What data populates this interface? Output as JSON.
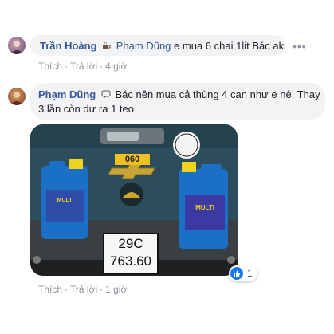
{
  "comments": [
    {
      "author": "Trần Hoàng",
      "mention": "Phạm Dũng",
      "text": "e mua 6 chai 1lit Bác ak",
      "actions": {
        "like": "Thích",
        "reply": "Trả lời",
        "time": "4 giờ"
      }
    },
    {
      "author": "Phạm Dũng",
      "text_line1": "Bác nên mua cả thùng 4 can như e nè. Thay",
      "text_line2": "3 lần còn dư ra 1 teo",
      "actions": {
        "like": "Thích",
        "reply": "Trả lời",
        "time": "1 giờ"
      },
      "reaction_count": "1"
    }
  ],
  "photo": {
    "plate_line1": "29C",
    "plate_line2": "763.60",
    "badge_small": "060",
    "left_bottle_label": "MULTI",
    "right_bottle_label": "MULTI"
  },
  "icons": {
    "emoji1": "coffee-emoji-icon",
    "emoji2": "speech-emoji-icon",
    "more": "more-options-icon",
    "like": "like-thumb-icon"
  },
  "colors": {
    "link": "#385898",
    "bubble": "#f2f3f5",
    "meta": "#90949c",
    "like": "#1877f2"
  }
}
